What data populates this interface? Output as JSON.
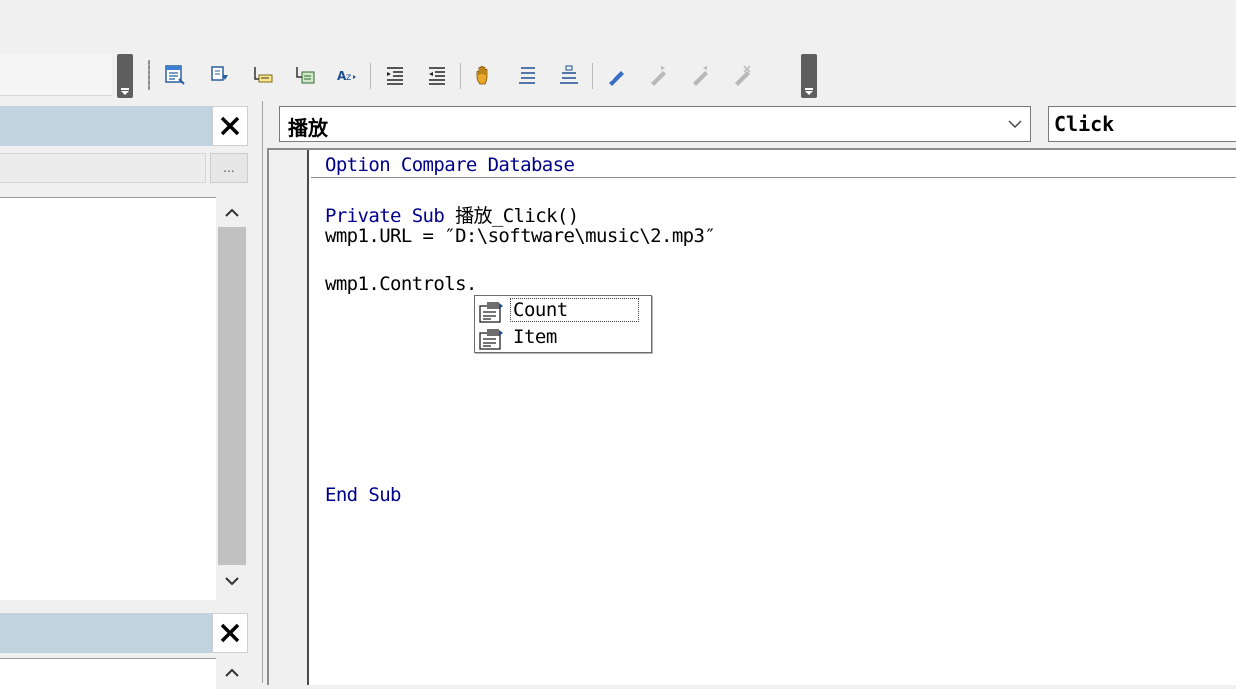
{
  "toolbar": {
    "buttons": [
      {
        "name": "properties-icon",
        "label": ""
      },
      {
        "name": "object-browser-icon",
        "label": ""
      },
      {
        "name": "list-properties-icon",
        "label": ""
      },
      {
        "name": "list-constants-icon",
        "label": ""
      },
      {
        "name": "quick-info-icon",
        "label": ""
      },
      {
        "name": "indent-icon",
        "label": ""
      },
      {
        "name": "outdent-icon",
        "label": ""
      },
      {
        "name": "toggle-breakpoint-icon",
        "label": ""
      },
      {
        "name": "comment-block-icon",
        "label": ""
      },
      {
        "name": "uncomment-block-icon",
        "label": ""
      },
      {
        "name": "toggle-bookmark-icon",
        "label": ""
      },
      {
        "name": "next-bookmark-icon",
        "label": ""
      },
      {
        "name": "previous-bookmark-icon",
        "label": ""
      },
      {
        "name": "clear-bookmarks-icon",
        "label": ""
      }
    ]
  },
  "left_panes": {
    "project_pane": {
      "close_label": "✕"
    },
    "filter": {
      "ellipsis_label": "..."
    },
    "properties_pane": {
      "close_label": "✕"
    }
  },
  "code_window": {
    "object_combo": {
      "value": "播放"
    },
    "procedure_combo": {
      "value": "Click"
    },
    "code_lines": {
      "line1": "Option Compare Database",
      "line2_kw": "Private Sub",
      "line2_rest": " 播放_Click()",
      "line3": "wmp1.URL = ″D:\\software\\music\\2.mp3″",
      "line4": "wmp1.Controls.",
      "line5": "End Sub"
    },
    "autocomplete": {
      "items": [
        "Count",
        "Item"
      ],
      "selected": "Count"
    }
  },
  "colors": {
    "keyword": "#00008b",
    "pane_title": "#c2d3e0",
    "toolbar_bg": "#f0f0f0"
  }
}
